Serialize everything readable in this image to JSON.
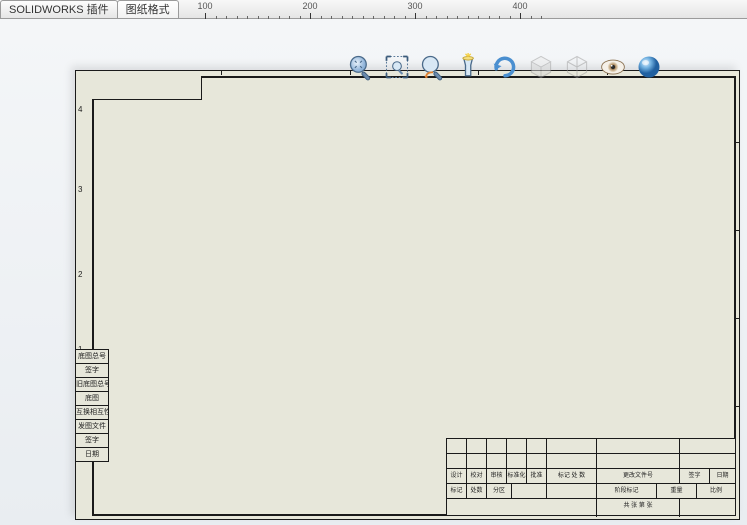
{
  "tabs": {
    "plugin": "SOLIDWORKS 插件",
    "sheetFormat": "图纸格式"
  },
  "ruler": {
    "marks": [
      100,
      200,
      300,
      400
    ]
  },
  "toolbar": {
    "zoomFit": "整屏显示",
    "zoomArea": "局部放大",
    "prevView": "上一视图",
    "sectionView": "剖面视图",
    "dynView": "视图定向",
    "displayStyle": "显示样式",
    "hideShow": "隐藏/显示",
    "appearance": "编辑外观"
  },
  "zones": {
    "rows": [
      "4",
      "3",
      "2",
      "1"
    ]
  },
  "leftStubs": [
    "底图总号",
    "签字",
    "旧底图总号",
    "底图",
    "互换相互性",
    "发图文件",
    "签字",
    "日期"
  ],
  "titleBlock": {
    "row1": [
      "",
      "",
      "",
      "",
      "",
      "",
      ""
    ],
    "row2": [
      "设计",
      "校对",
      "审核",
      "标准化",
      "批准",
      "标记 处 数",
      "更改文件号",
      "签字",
      "日期"
    ],
    "row3": [
      "标记",
      "处数",
      "分区",
      "",
      "",
      "阶段标记",
      "重量",
      "比例"
    ],
    "row4": [
      "",
      "",
      "",
      "",
      "",
      "共 张  第 张",
      ""
    ]
  }
}
